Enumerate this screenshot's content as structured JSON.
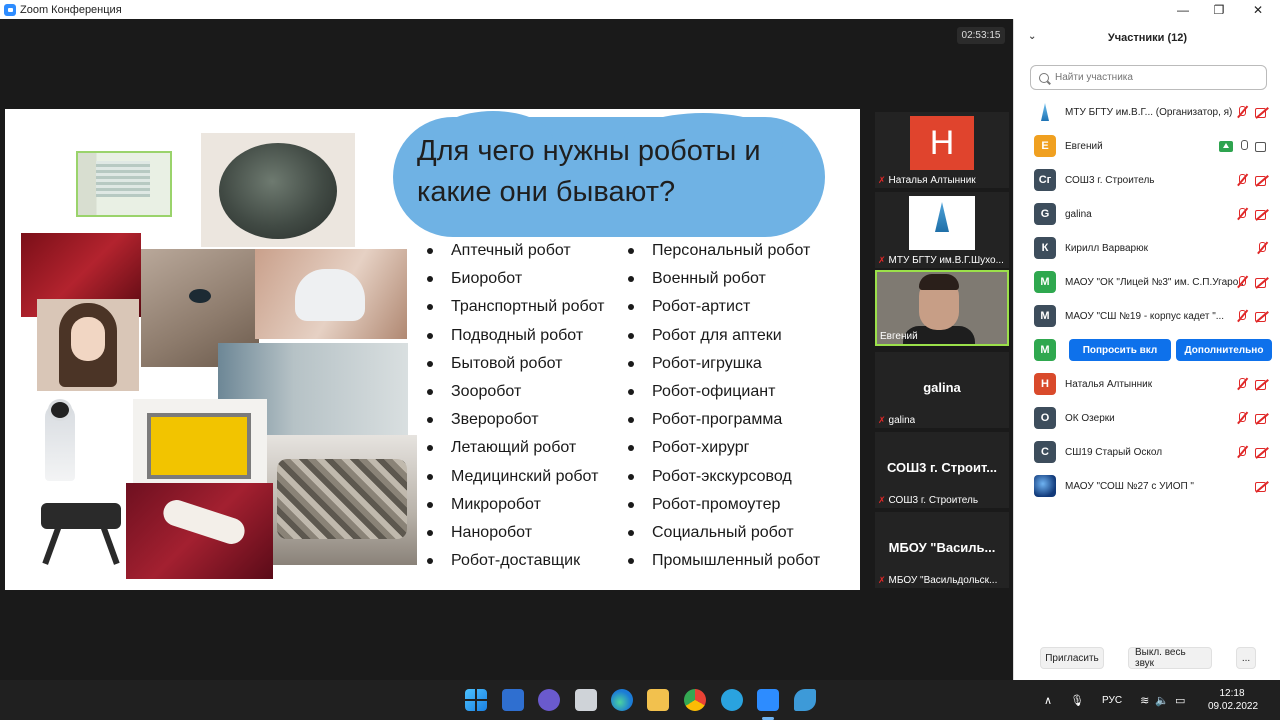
{
  "window": {
    "title": "Zoom Конференция",
    "controls": [
      "—",
      "❐",
      "✕"
    ]
  },
  "meeting": {
    "timer": "02:53:15"
  },
  "slide": {
    "title": "Для чего нужны роботы и какие они бывают?",
    "left_column": [
      "Аптечный робот",
      "Биоробот",
      "Транспортный робот",
      "Подводный робот",
      "Бытовой робот",
      "Зооробот",
      "Звероробот",
      "Летающий робот",
      "Медицинский робот",
      "Микроробот",
      "Наноробот",
      "Робот-доставщик"
    ],
    "right_column": [
      "Персональный робот",
      "Военный робот",
      "Робот-артист",
      "Робот для аптеки",
      "Робот-игрушка",
      "Робот-официант",
      "Робот-программа",
      "Робот-хирург",
      "Робот-экскурсовод",
      "Робот-промоутер",
      "Социальный робот",
      "Промышленный робот"
    ]
  },
  "video_tiles": [
    {
      "name": "Наталья Алтынник",
      "avatar_letter": "Н",
      "avatar_color": "#e0442d",
      "muted": true
    },
    {
      "name": "МТУ БГТУ им.В.Г.Шухо...",
      "muted": true
    },
    {
      "name": "Евгений",
      "muted": false,
      "active": true
    },
    {
      "name": "galina",
      "big_text": "galina",
      "muted": true
    },
    {
      "name": "СОШ3 г. Строитель",
      "big_text": "СОШ3 г. Строит...",
      "muted": true
    },
    {
      "name": "МБОУ \"Васильдольск...",
      "big_text": "МБОУ  \"Василь...",
      "muted": true
    }
  ],
  "participants_panel": {
    "title": "Участники (12)",
    "search_placeholder": "Найти участника",
    "participants": [
      {
        "name": "МТУ БГТУ им.В.Г... (Организатор, я)",
        "avatar": "",
        "avatar_type": "logo",
        "color": "#ffffff",
        "muted": true,
        "video_off": true
      },
      {
        "name": "Евгений",
        "avatar": "Е",
        "color": "#f0a020",
        "sharing": true,
        "mic_on": true,
        "video_on": true
      },
      {
        "name": "СОШ3 г. Строитель",
        "avatar": "Сг",
        "color": "#3d4d5c",
        "muted": true,
        "video_off": true
      },
      {
        "name": "galina",
        "avatar": "G",
        "color": "#3d4d5c",
        "muted": true,
        "video_off": true
      },
      {
        "name": "Кирилл Варварюк",
        "avatar": "К",
        "color": "#3d4d5c",
        "muted": true
      },
      {
        "name": "МАОУ \"ОК \"Лицей №3\" им. С.П.Угаро...",
        "avatar": "М",
        "color": "#2fa84f",
        "muted": true,
        "video_off": true
      },
      {
        "name": "МАОУ \"СШ №19 - корпус кадет \"...",
        "avatar": "М",
        "color": "#3d4d5c",
        "muted": true,
        "video_off": true
      },
      {
        "name": "",
        "avatar": "М",
        "color": "#2fa84f",
        "buttons": [
          "Попросить вкл",
          "Дополнительно"
        ]
      },
      {
        "name": "Наталья Алтынник",
        "avatar": "Н",
        "color": "#d94a2b",
        "muted": true,
        "video_off": true
      },
      {
        "name": "ОК Озерки",
        "avatar": "О",
        "color": "#3d4d5c",
        "muted": true,
        "video_off": true
      },
      {
        "name": "СШ19 Старый Оскол",
        "avatar": "С",
        "color": "#3d4d5c",
        "muted": true,
        "video_off": true
      },
      {
        "name": "МАОУ \"СОШ №27 с УИОП \"",
        "avatar": "",
        "avatar_type": "globe",
        "color": "#1b4a8a",
        "video_off": true
      }
    ],
    "footer": {
      "invite": "Пригласить",
      "mute_all": "Выкл. весь звук",
      "more": "..."
    }
  },
  "taskbar": {
    "language": "РУС",
    "time": "12:18",
    "date": "09.02.2022",
    "apps": [
      "start-icon",
      "widgets-icon",
      "teams-chat-icon",
      "printer-icon",
      "edge-icon",
      "file-explorer-icon",
      "chrome-icon",
      "telegram-icon",
      "zoom-icon",
      "app-icon"
    ]
  }
}
